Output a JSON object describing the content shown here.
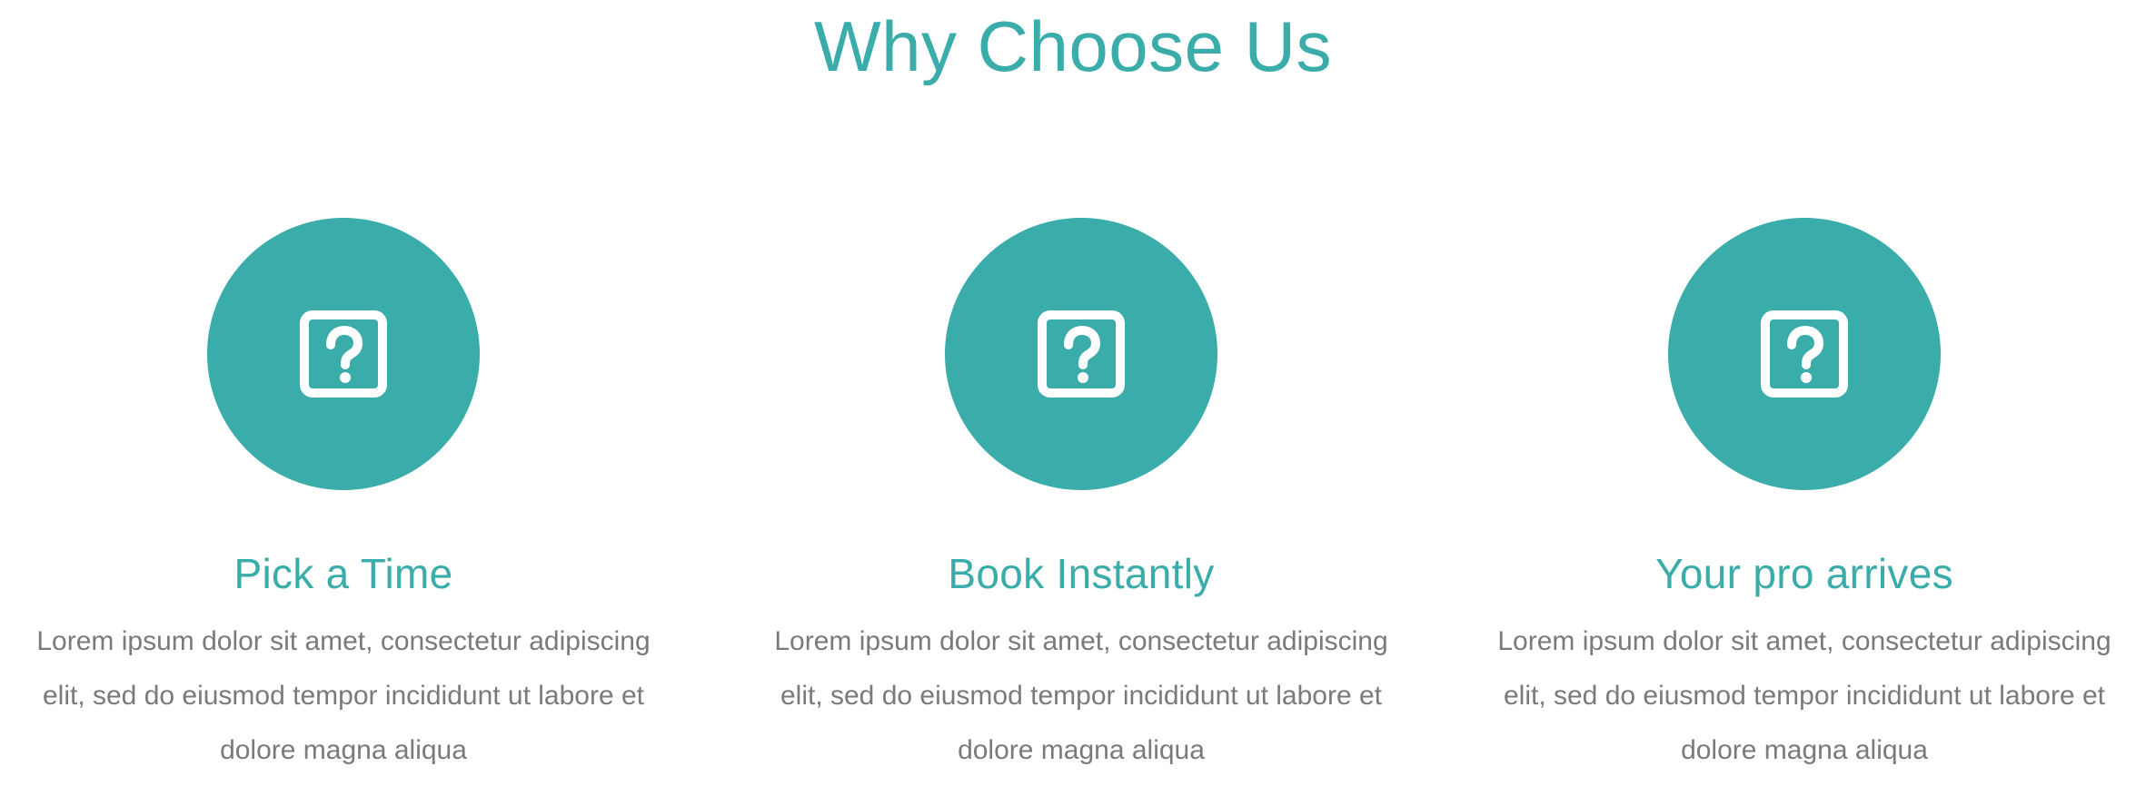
{
  "theme": {
    "accent": "#3aaca9",
    "icon_fg": "#ffffff",
    "body_text": "#7a7a7a"
  },
  "section": {
    "title": "Why Choose Us"
  },
  "features": [
    {
      "icon": "question-mark-square-icon",
      "title": "Pick a Time",
      "description": "Lorem ipsum dolor sit amet, consectetur adipiscing elit, sed do eiusmod tempor incididunt ut labore et dolore magna aliqua"
    },
    {
      "icon": "question-mark-square-icon",
      "title": "Book Instantly",
      "description": "Lorem ipsum dolor sit amet, consectetur adipiscing elit, sed do eiusmod tempor incididunt ut labore et dolore magna aliqua"
    },
    {
      "icon": "question-mark-square-icon",
      "title": "Your pro arrives",
      "description": "Lorem ipsum dolor sit amet, consectetur adipiscing elit, sed do eiusmod tempor incididunt ut labore et dolore magna aliqua"
    }
  ]
}
